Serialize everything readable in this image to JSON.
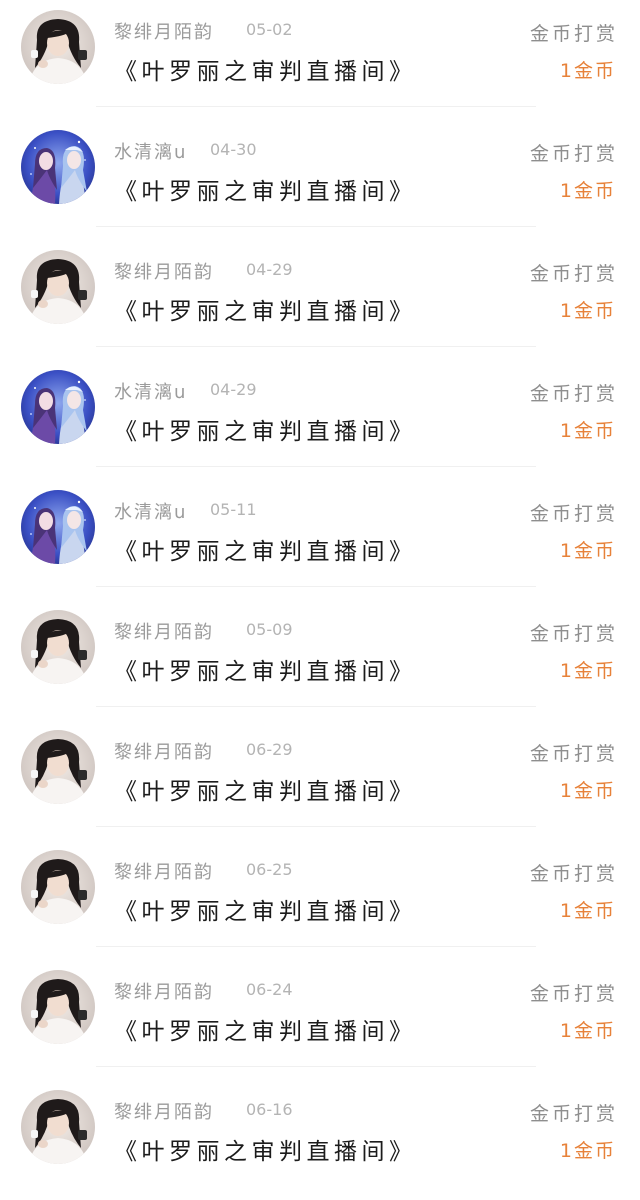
{
  "colors": {
    "username": "#9b9b9b",
    "date": "#b4b4b4",
    "title": "#1c1c1c",
    "reward_type": "#8e8e8e",
    "reward_amount": "#e7823a"
  },
  "records": [
    {
      "avatar": "girl-photo-avatar",
      "username": "黎绯月陌韵",
      "date": "05-02",
      "title": "《叶罗丽之审判直播间》",
      "reward_type": "金币打赏",
      "reward_amount": "1金币"
    },
    {
      "avatar": "anime-couple-avatar",
      "username": "水清漓u",
      "date": "04-30",
      "title": "《叶罗丽之审判直播间》",
      "reward_type": "金币打赏",
      "reward_amount": "1金币"
    },
    {
      "avatar": "girl-photo-avatar",
      "username": "黎绯月陌韵",
      "date": "04-29",
      "title": "《叶罗丽之审判直播间》",
      "reward_type": "金币打赏",
      "reward_amount": "1金币"
    },
    {
      "avatar": "anime-couple-avatar",
      "username": "水清漓u",
      "date": "04-29",
      "title": "《叶罗丽之审判直播间》",
      "reward_type": "金币打赏",
      "reward_amount": "1金币"
    },
    {
      "avatar": "anime-couple-avatar",
      "username": "水清漓u",
      "date": "05-11",
      "title": "《叶罗丽之审判直播间》",
      "reward_type": "金币打赏",
      "reward_amount": "1金币"
    },
    {
      "avatar": "girl-photo-avatar",
      "username": "黎绯月陌韵",
      "date": "05-09",
      "title": "《叶罗丽之审判直播间》",
      "reward_type": "金币打赏",
      "reward_amount": "1金币"
    },
    {
      "avatar": "girl-photo-avatar",
      "username": "黎绯月陌韵",
      "date": "06-29",
      "title": "《叶罗丽之审判直播间》",
      "reward_type": "金币打赏",
      "reward_amount": "1金币"
    },
    {
      "avatar": "girl-photo-avatar",
      "username": "黎绯月陌韵",
      "date": "06-25",
      "title": "《叶罗丽之审判直播间》",
      "reward_type": "金币打赏",
      "reward_amount": "1金币"
    },
    {
      "avatar": "girl-photo-avatar",
      "username": "黎绯月陌韵",
      "date": "06-24",
      "title": "《叶罗丽之审判直播间》",
      "reward_type": "金币打赏",
      "reward_amount": "1金币"
    },
    {
      "avatar": "girl-photo-avatar",
      "username": "黎绯月陌韵",
      "date": "06-16",
      "title": "《叶罗丽之审判直播间》",
      "reward_type": "金币打赏",
      "reward_amount": "1金币"
    }
  ]
}
